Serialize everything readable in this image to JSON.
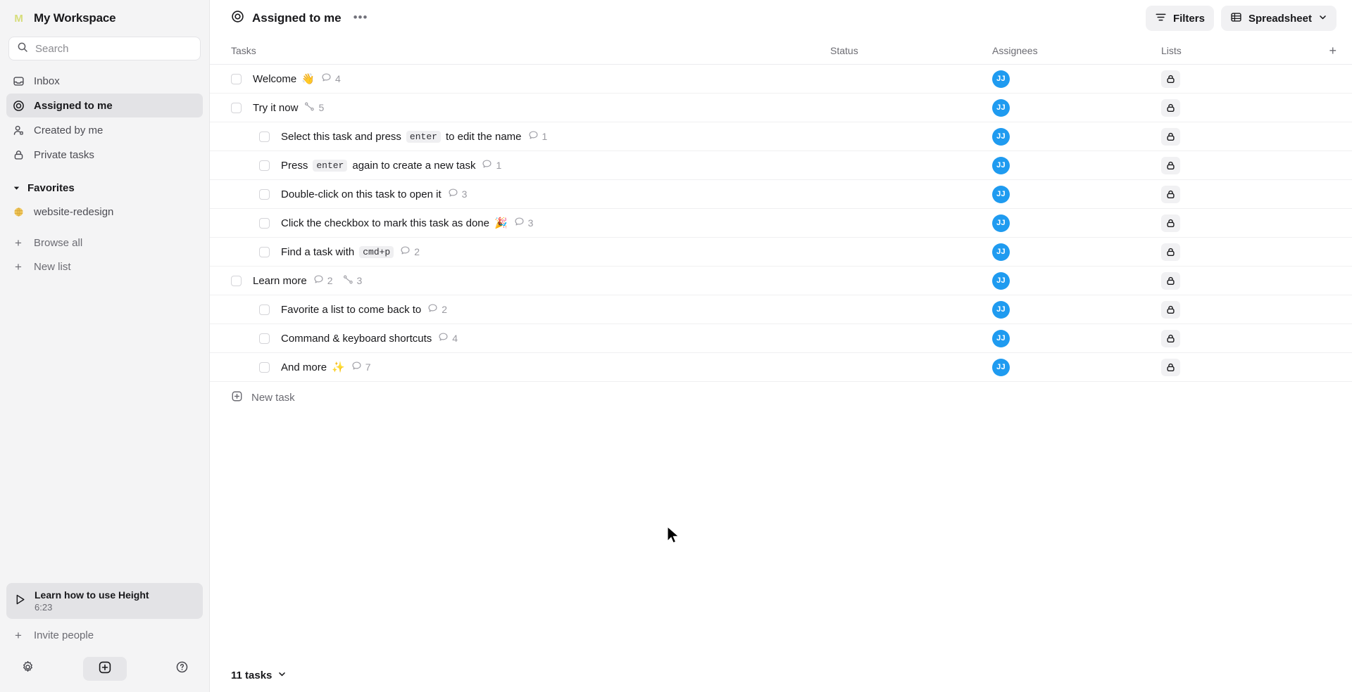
{
  "sidebar": {
    "workspace": {
      "logo_letter": "M",
      "name": "My Workspace"
    },
    "search": {
      "placeholder": "Search",
      "icon": "search-icon"
    },
    "nav": [
      {
        "id": "inbox",
        "label": "Inbox",
        "icon": "inbox-icon",
        "active": false
      },
      {
        "id": "assigned-to-me",
        "label": "Assigned to me",
        "icon": "target-icon",
        "active": true
      },
      {
        "id": "created-by-me",
        "label": "Created by me",
        "icon": "user-icon",
        "active": false
      },
      {
        "id": "private-tasks",
        "label": "Private tasks",
        "icon": "lock-icon",
        "active": false
      }
    ],
    "favorites": {
      "label": "Favorites",
      "caret": "chevron-down-icon",
      "color": "#e0b341",
      "items": [
        {
          "id": "website-redesign",
          "label": "website-redesign",
          "icon": "globe-icon"
        }
      ]
    },
    "actions": [
      {
        "id": "browse-all",
        "label": "Browse all",
        "icon": "plus-icon"
      },
      {
        "id": "new-list",
        "label": "New list",
        "icon": "plus-icon"
      }
    ],
    "promo": {
      "title": "Learn how to use Height",
      "duration": "6:23",
      "icon": "play-icon"
    },
    "invite": {
      "label": "Invite people",
      "icon": "plus-icon"
    },
    "footer": [
      {
        "id": "settings",
        "icon": "gear-icon"
      },
      {
        "id": "create",
        "icon": "plus-square-icon"
      },
      {
        "id": "help",
        "icon": "question-circle-icon"
      }
    ]
  },
  "topbar": {
    "view_icon": "target-icon",
    "view_title": "Assigned to me",
    "more": "•••",
    "filters_label": "Filters",
    "filters_icon": "filter-icon",
    "view_label": "Spreadsheet",
    "view_mode_icon": "table-icon",
    "view_chevron": "chevron-down-icon"
  },
  "table": {
    "columns": {
      "tasks": "Tasks",
      "status": "Status",
      "assignees": "Assignees",
      "lists": "Lists",
      "add": "+"
    },
    "rows": [
      {
        "id": "welcome",
        "indent": 0,
        "name": "Welcome",
        "emoji": "👋",
        "comments": "4",
        "subtasks": null,
        "assignee": "JJ",
        "list_icon": "lock-icon"
      },
      {
        "id": "try-it-now",
        "indent": 0,
        "name": "Try it now",
        "emoji": "",
        "comments": null,
        "subtasks": "5",
        "assignee": "JJ",
        "list_icon": "lock-icon"
      },
      {
        "id": "select-task-enter",
        "indent": 1,
        "name_pre": "Select this task and press",
        "kbd": "enter",
        "name_post": "to edit the name",
        "comments": "1",
        "subtasks": null,
        "assignee": "JJ",
        "list_icon": "lock-icon"
      },
      {
        "id": "press-enter-again",
        "indent": 1,
        "name_pre": "Press",
        "kbd": "enter",
        "name_post": "again to create a new task",
        "comments": "1",
        "subtasks": null,
        "assignee": "JJ",
        "list_icon": "lock-icon"
      },
      {
        "id": "double-click-open",
        "indent": 1,
        "name": "Double-click on this task to open it",
        "emoji": "",
        "comments": "3",
        "subtasks": null,
        "assignee": "JJ",
        "list_icon": "lock-icon"
      },
      {
        "id": "click-checkbox-done",
        "indent": 1,
        "name": "Click the checkbox to mark this task as done",
        "emoji": "🎉",
        "comments": "3",
        "subtasks": null,
        "assignee": "JJ",
        "list_icon": "lock-icon"
      },
      {
        "id": "find-task-cmdp",
        "indent": 1,
        "name_pre": "Find a task with",
        "kbd": "cmd+p",
        "name_post": "",
        "comments": "2",
        "subtasks": null,
        "assignee": "JJ",
        "list_icon": "lock-icon"
      },
      {
        "id": "learn-more",
        "indent": 0,
        "name": "Learn more",
        "emoji": "",
        "comments": "2",
        "subtasks": "3",
        "assignee": "JJ",
        "list_icon": "lock-icon"
      },
      {
        "id": "favorite-a-list",
        "indent": 1,
        "name": "Favorite a list to come back to",
        "emoji": "",
        "comments": "2",
        "subtasks": null,
        "assignee": "JJ",
        "list_icon": "lock-icon"
      },
      {
        "id": "command-keyboard-shortcuts",
        "indent": 1,
        "name": "Command & keyboard shortcuts",
        "emoji": "",
        "comments": "4",
        "subtasks": null,
        "assignee": "JJ",
        "list_icon": "lock-icon"
      },
      {
        "id": "and-more",
        "indent": 1,
        "name": "And more",
        "emoji": "✨",
        "comments": "7",
        "subtasks": null,
        "assignee": "JJ",
        "list_icon": "lock-icon"
      }
    ],
    "new_task": {
      "label": "New task",
      "icon": "plus-square-icon"
    },
    "footer": {
      "count_label": "11 tasks",
      "chevron": "chevron-down-icon"
    }
  },
  "colors": {
    "accent_avatar": "#1f9bf0",
    "sidebar_bg": "#f4f4f5",
    "active_bg": "#e3e3e6",
    "logo": "#d6dd7a"
  }
}
